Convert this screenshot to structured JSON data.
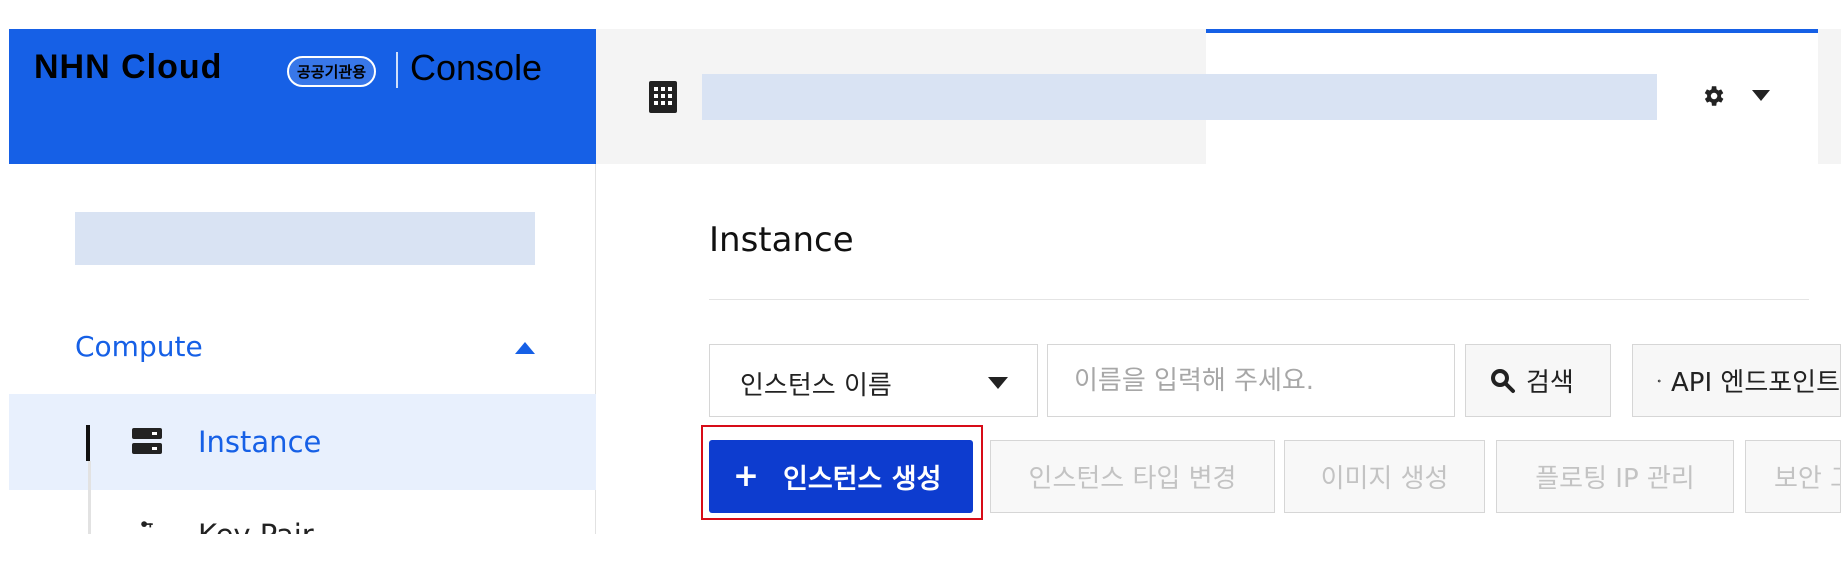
{
  "brand": {
    "logo_text": "NHN Cloud",
    "badge_text": "공공기관용",
    "console_text": "Console",
    "primary_color": "#1660e6"
  },
  "header": {
    "org_icon": "grid-icon",
    "gear_icon": "gear-icon",
    "dropdown_icon": "caret-down-icon"
  },
  "sidebar": {
    "section_title": "Compute",
    "section_icon": "caret-up-icon",
    "items": [
      {
        "label": "Instance",
        "icon": "server-icon",
        "active": true
      },
      {
        "label": "Key Pair",
        "icon": "key-icon",
        "active": false
      }
    ]
  },
  "main": {
    "title": "Instance",
    "search": {
      "select_value": "인스턴스 이름",
      "placeholder": "이름을 입력해 주세요.",
      "search_label": "검색",
      "api_label": "API 엔드포인트"
    },
    "actions": {
      "create_label": "인스턴스 생성",
      "change_type_label": "인스턴스 타입 변경",
      "create_image_label": "이미지 생성",
      "floating_ip_label": "플로팅 IP 관리",
      "security_label": "보안 그룹 변경"
    },
    "colors": {
      "create_button": "#0d3ccf",
      "highlight": "#d70c18"
    }
  }
}
